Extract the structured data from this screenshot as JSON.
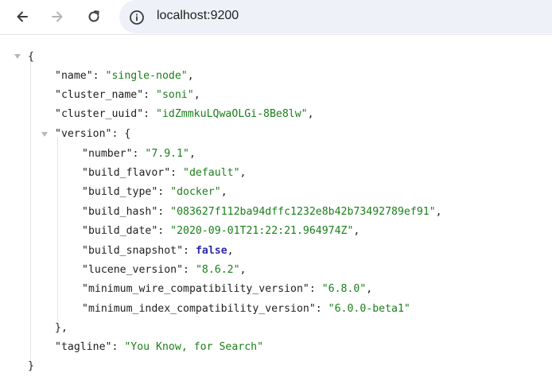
{
  "browser": {
    "url": "localhost:9200"
  },
  "json": {
    "name_key": "\"name\"",
    "name_val": "\"single-node\"",
    "cluster_name_key": "\"cluster_name\"",
    "cluster_name_val": "\"soni\"",
    "cluster_uuid_key": "\"cluster_uuid\"",
    "cluster_uuid_val": "\"idZmmkuLQwaOLGi-8Be8lw\"",
    "version_key": "\"version\"",
    "version": {
      "number_key": "\"number\"",
      "number_val": "\"7.9.1\"",
      "build_flavor_key": "\"build_flavor\"",
      "build_flavor_val": "\"default\"",
      "build_type_key": "\"build_type\"",
      "build_type_val": "\"docker\"",
      "build_hash_key": "\"build_hash\"",
      "build_hash_val": "\"083627f112ba94dffc1232e8b42b73492789ef91\"",
      "build_date_key": "\"build_date\"",
      "build_date_val": "\"2020-09-01T21:22:21.964974Z\"",
      "build_snapshot_key": "\"build_snapshot\"",
      "build_snapshot_val": "false",
      "lucene_version_key": "\"lucene_version\"",
      "lucene_version_val": "\"8.6.2\"",
      "min_wire_key": "\"minimum_wire_compatibility_version\"",
      "min_wire_val": "\"6.8.0\"",
      "min_index_key": "\"minimum_index_compatibility_version\"",
      "min_index_val": "\"6.0.0-beta1\""
    },
    "tagline_key": "\"tagline\"",
    "tagline_val": "\"You Know, for Search\""
  },
  "colors": {
    "string": "#1a7f1a",
    "boolean": "#2b2ba6",
    "omnibox": "#eef1f8"
  }
}
